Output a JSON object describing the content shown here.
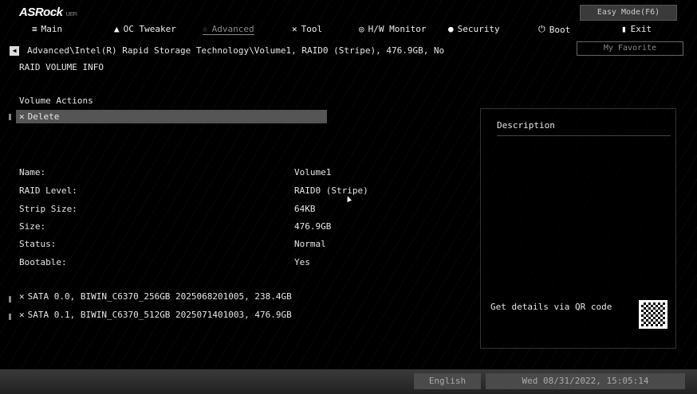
{
  "header": {
    "brand": "ASRock",
    "brand_sub": "UEFI",
    "easy_mode": "Easy Mode(F6)",
    "my_favorite": "My Favorite"
  },
  "tabs": [
    {
      "label": "Main",
      "icon": "≡"
    },
    {
      "label": "OC Tweaker",
      "icon": "▲"
    },
    {
      "label": "Advanced",
      "icon": "☆"
    },
    {
      "label": "Tool",
      "icon": "✕"
    },
    {
      "label": "H/W Monitor",
      "icon": "◎"
    },
    {
      "label": "Security",
      "icon": "●"
    },
    {
      "label": "Boot",
      "icon": "⏻"
    },
    {
      "label": "Exit",
      "icon": "▮"
    }
  ],
  "breadcrumb": "Advanced\\Intel(R) Rapid Storage Technology\\Volume1, RAID0 (Stripe), 476.9GB, No",
  "subtitle": "RAID VOLUME INFO",
  "volume_actions": {
    "title": "Volume Actions",
    "delete": "Delete"
  },
  "info": [
    {
      "label": "Name:",
      "value": "Volume1"
    },
    {
      "label": "RAID Level:",
      "value": "RAID0 (Stripe)"
    },
    {
      "label": "Strip Size:",
      "value": "64KB"
    },
    {
      "label": "Size:",
      "value": "476.9GB"
    },
    {
      "label": "Status:",
      "value": "Normal"
    },
    {
      "label": "Bootable:",
      "value": "Yes"
    }
  ],
  "disks": [
    "SATA 0.0, BIWIN_C6370_256GB 2025068201005, 238.4GB",
    "SATA 0.1, BIWIN_C6370_512GB 2025071401003, 476.9GB"
  ],
  "description": {
    "title": "Description",
    "qr_text": "Get details via QR code"
  },
  "footer": {
    "language": "English",
    "datetime": "Wed 08/31/2022, 15:05:14"
  }
}
